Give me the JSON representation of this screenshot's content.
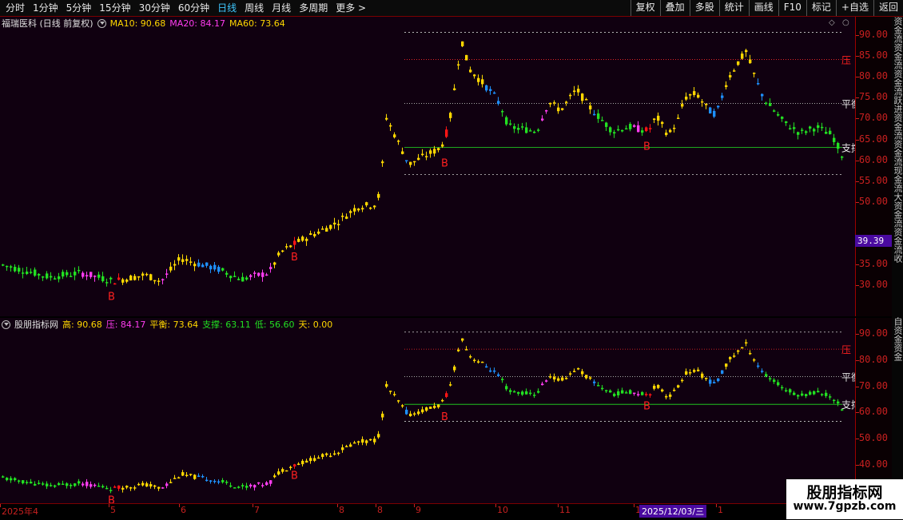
{
  "toolbar": {
    "periods": [
      "分时",
      "1分钟",
      "5分钟",
      "15分钟",
      "30分钟",
      "60分钟",
      "日线",
      "周线",
      "月线",
      "多周期",
      "更多 >"
    ],
    "active": "日线",
    "right_buttons": [
      "复权",
      "叠加",
      "多股",
      "统计",
      "画线",
      "F10",
      "标记",
      "+自选",
      "返回"
    ]
  },
  "main": {
    "title": "福瑞医科 (日线 前复权)",
    "ma": [
      {
        "label": "MA10: 90.68",
        "color": "#ffd700"
      },
      {
        "label": "MA20: 84.17",
        "color": "#ff3cf0"
      },
      {
        "label": "MA60: 73.64",
        "color": "#ffd700"
      }
    ],
    "level_labels": {
      "ya": "压",
      "pingheng": "平衡",
      "zhicheng": "支撑"
    },
    "y_ticks": [
      "90.00",
      "85.00",
      "80.00",
      "75.00",
      "70.00",
      "65.00",
      "60.00",
      "55.00",
      "50.00",
      "35.00",
      "30.00"
    ],
    "price_tag": "39.39",
    "right_strip": "资金流资金流资金流跃进资金流资金流现金流大资金流资金流收"
  },
  "sub": {
    "title": "股朋指标网",
    "items": [
      {
        "label": "高: 90.68",
        "color": "#ffd700"
      },
      {
        "label": "压: 84.17",
        "color": "#ff3cf0"
      },
      {
        "label": "平衡: 73.64",
        "color": "#ffd700"
      },
      {
        "label": "支撑: 63.11",
        "color": "#22e022"
      },
      {
        "label": "低: 56.60",
        "color": "#22e022"
      },
      {
        "label": "天: 0.00",
        "color": "#ffd700"
      }
    ],
    "y_ticks": [
      "90.00",
      "80.00",
      "70.00",
      "60.00",
      "50.00",
      "40.00"
    ],
    "right_strip": "自资金资金"
  },
  "levels": {
    "high": 90.68,
    "ya": 84.17,
    "balance": 73.64,
    "support": 63.11,
    "low": 56.6
  },
  "signal_label": "B",
  "x_axis": {
    "labels": [
      "2025年4",
      "5",
      "6",
      "7",
      "8",
      "8",
      "9",
      "10",
      "11",
      "1",
      "1"
    ],
    "selected_date": "2025/12/03/三"
  },
  "watermark": {
    "line1": "股朋指标网",
    "line2": "www.7gpzb.com"
  },
  "colors": {
    "gold": "#ffd700",
    "red": "#ff1515",
    "green": "#22e022",
    "blue": "#1e90ff",
    "magenta": "#ff3cf0"
  }
}
